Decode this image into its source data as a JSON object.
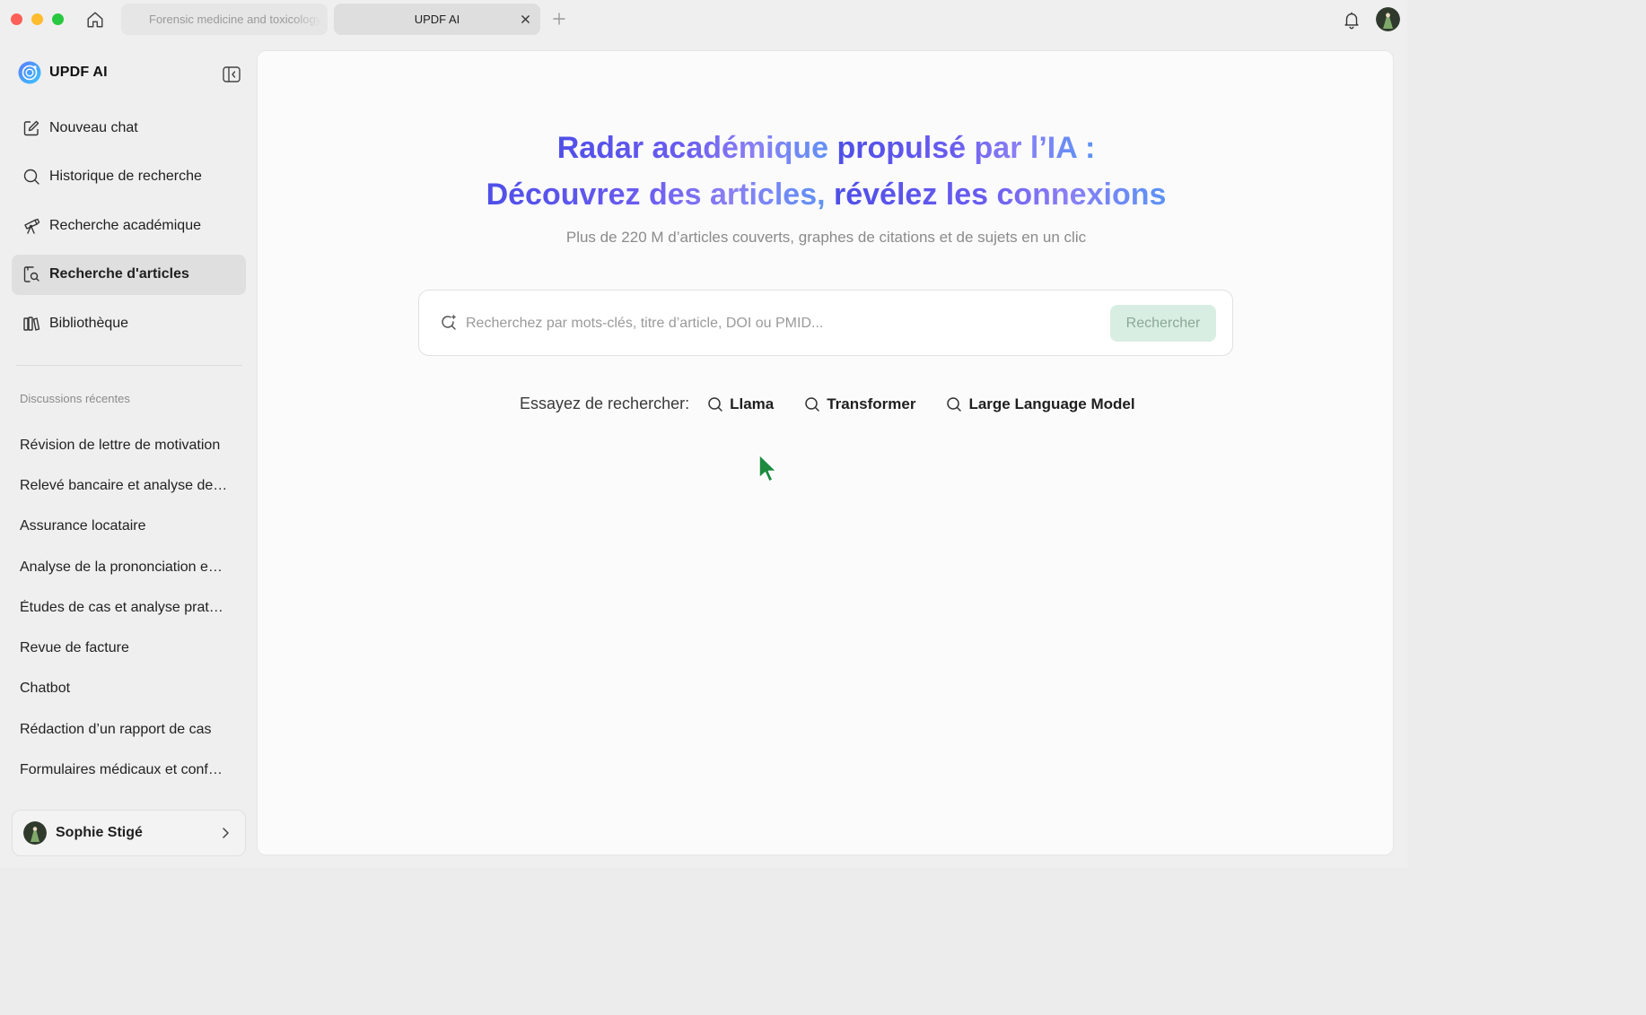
{
  "window": {
    "tabs": [
      {
        "label": "Forensic medicine and toxicology",
        "active": false
      },
      {
        "label": "UPDF AI",
        "active": true
      }
    ]
  },
  "sidebar": {
    "brand": "UPDF AI",
    "nav": [
      {
        "label": "Nouveau chat",
        "icon": "edit-icon"
      },
      {
        "label": "Historique de recherche",
        "icon": "search-icon"
      },
      {
        "label": "Recherche académique",
        "icon": "telescope-icon"
      },
      {
        "label": "Recherche d'articles",
        "icon": "document-search-icon",
        "active": true
      },
      {
        "label": "Bibliothèque",
        "icon": "library-icon"
      }
    ],
    "recent_title": "Discussions récentes",
    "recent": [
      "Révision de lettre de motivation",
      "Relevé bancaire et analyse de…",
      "Assurance locataire",
      "Analyse de la prononciation e…",
      "Études de cas et analyse prat…",
      "Revue de facture",
      "Chatbot",
      "Rédaction d’un rapport de cas",
      "Formulaires médicaux et conf…"
    ],
    "user": {
      "name": "Sophie Stigé"
    }
  },
  "main": {
    "headline_line1_a": "Radar académique ",
    "headline_line1_b": "propulsé par l’IA :",
    "headline_line2_a": "Découvrez des articles, ",
    "headline_line2_b": "révélez les connexions",
    "subtitle": "Plus de 220 M d’articles couverts, graphes de citations et de sujets en un clic",
    "search": {
      "placeholder": "Recherchez par mots-clés, titre d’article, DOI ou PMID...",
      "value": "",
      "button": "Rechercher"
    },
    "suggestions_label": "Essayez de rechercher:",
    "suggestions": [
      "Llama",
      "Transformer",
      "Large Language Model"
    ]
  },
  "colors": {
    "accent_gradient_start": "#4f4fe8",
    "accent_gradient_end": "#5b93f5",
    "search_button_bg": "#d9eee2",
    "active_nav_bg": "#dfdfdf"
  }
}
